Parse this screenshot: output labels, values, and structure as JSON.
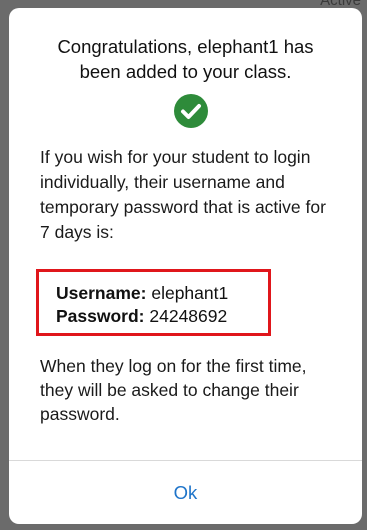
{
  "background": {
    "fragment_text": "Active"
  },
  "dialog": {
    "title": "Congratulations, elephant1 has been added to your class.",
    "status_icon": "check-circle-icon",
    "accent_color": "#2e8b3a",
    "message": "If you wish for your student to login individually, their username and temporary password that is active for 7 days is:",
    "credentials": {
      "username_label": "Username:",
      "username_value": "elephant1",
      "password_label": "Password:",
      "password_value": "24248692",
      "highlight_color": "#e0161b"
    },
    "footer_message": "When they log on for the first time, they will be asked to change their password.",
    "ok_label": "Ok",
    "link_color": "#1e74c9"
  }
}
